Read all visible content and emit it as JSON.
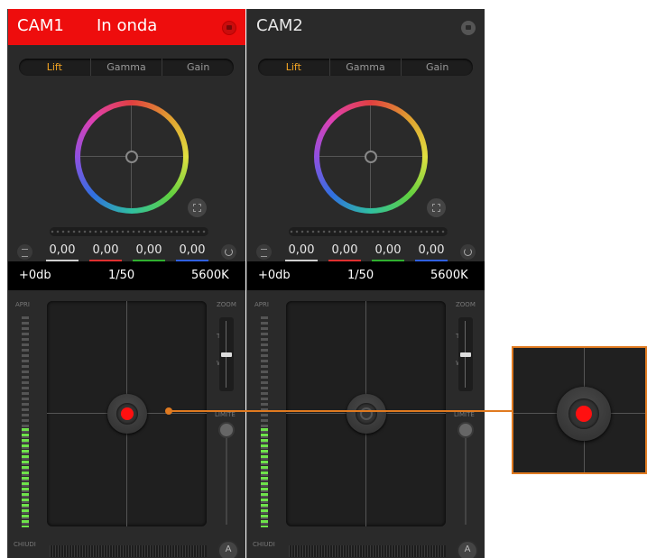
{
  "cameras": [
    {
      "name": "CAM1",
      "status": "In onda",
      "tabs": [
        "Lift",
        "Gamma",
        "Gain"
      ],
      "active_tab": "Lift",
      "values": [
        "0,00",
        "0,00",
        "0,00",
        "0,00"
      ],
      "settings": {
        "gain": "+0db",
        "shutter": "1/50",
        "white_balance": "5600K"
      },
      "labels": {
        "iris_open": "APRI",
        "iris_close": "CHIUDI",
        "zoom": "ZOOM",
        "zoom_tele": "T",
        "zoom_wide": "W",
        "limit": "LIMITE"
      },
      "on_air": true
    },
    {
      "name": "CAM2",
      "status": "",
      "tabs": [
        "Lift",
        "Gamma",
        "Gain"
      ],
      "active_tab": "Lift",
      "values": [
        "0,00",
        "0,00",
        "0,00",
        "0,00"
      ],
      "settings": {
        "gain": "+0db",
        "shutter": "1/50",
        "white_balance": "5600K"
      },
      "labels": {
        "iris_open": "APRI",
        "iris_close": "CHIUDI",
        "zoom": "ZOOM",
        "zoom_tele": "T",
        "zoom_wide": "W",
        "limit": "LIMITE"
      },
      "on_air": false
    }
  ],
  "colors": {
    "on_air": "#ee0d0d",
    "accent": "#f5a623",
    "callout": "#e07a20",
    "meter": "#6ee24a"
  },
  "icons": {
    "lock": "lock-icon",
    "expand": "expand-icon",
    "menu": "menu-icon",
    "reset": "reset-icon",
    "auto": "auto-iris-icon"
  }
}
